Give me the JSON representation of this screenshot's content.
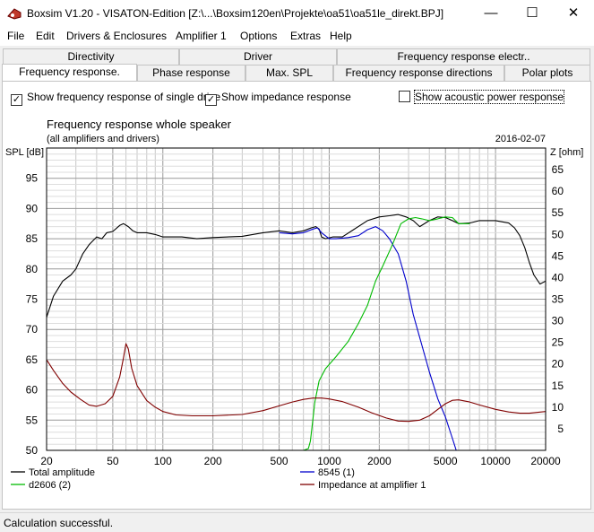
{
  "window": {
    "title": "Boxsim V1.20 - VISATON-Edition [Z:\\...\\Boxsim120en\\Projekte\\oa51\\oa51le_direkt.BPJ]",
    "minimize": "—",
    "maximize": "☐",
    "close": "✕"
  },
  "menu": [
    "File",
    "Edit",
    "Drivers & Enclosures",
    "Amplifier 1",
    "Options",
    "Extras",
    "Help"
  ],
  "tabs_row1": [
    "Directivity",
    "Driver",
    "Frequency response electr.."
  ],
  "tabs_row2": [
    "Frequency response.",
    "Phase response",
    "Max. SPL",
    "Frequency response directions",
    "Polar plots"
  ],
  "options": {
    "single_drive": {
      "label": "Show frequency response of single drive",
      "checked": true
    },
    "impedance": {
      "label": "Show impedance response",
      "checked": true
    },
    "acoustic_power": {
      "label": "Show acoustic power response",
      "checked": false
    }
  },
  "status": "Calculation successful.",
  "chart_data": {
    "type": "line",
    "title": "Frequency response whole speaker",
    "subtitle": "(all amplifiers and drivers)",
    "date": "2016-02-07",
    "ylabel": "SPL [dB]",
    "y2label": "Z [ohm]",
    "xscale": "log",
    "xlim": [
      20,
      20000
    ],
    "ylim": [
      50,
      100
    ],
    "y2lim": [
      0,
      70
    ],
    "x_ticks": [
      20,
      50,
      100,
      200,
      500,
      1000,
      2000,
      5000,
      10000,
      20000
    ],
    "x_tick_labels": [
      "20",
      "50",
      "100",
      "200",
      "500",
      "1000",
      "2000",
      "5000",
      "10000",
      "20000"
    ],
    "y_ticks": [
      50,
      55,
      60,
      65,
      70,
      75,
      80,
      85,
      90,
      95
    ],
    "y2_ticks": [
      5,
      10,
      15,
      20,
      25,
      30,
      35,
      40,
      45,
      50,
      55,
      60,
      65
    ],
    "grid": true,
    "legend_position": "bottom",
    "series": [
      {
        "name": "Total amplitude",
        "axis": "spl",
        "color": "#000000",
        "points": [
          [
            20,
            72
          ],
          [
            22,
            75.5
          ],
          [
            25,
            78
          ],
          [
            28,
            79
          ],
          [
            30,
            80
          ],
          [
            33,
            82.5
          ],
          [
            36,
            84
          ],
          [
            40,
            85.3
          ],
          [
            43,
            85
          ],
          [
            46,
            86
          ],
          [
            50,
            86.2
          ],
          [
            55,
            87.2
          ],
          [
            58,
            87.5
          ],
          [
            62,
            87
          ],
          [
            66,
            86.3
          ],
          [
            70,
            86
          ],
          [
            80,
            86
          ],
          [
            90,
            85.7
          ],
          [
            100,
            85.3
          ],
          [
            130,
            85.3
          ],
          [
            160,
            85
          ],
          [
            200,
            85.2
          ],
          [
            300,
            85.4
          ],
          [
            400,
            86
          ],
          [
            500,
            86.3
          ],
          [
            600,
            86
          ],
          [
            700,
            86.3
          ],
          [
            780,
            86.8
          ],
          [
            830,
            87
          ],
          [
            870,
            86.6
          ],
          [
            900,
            85.3
          ],
          [
            950,
            85
          ],
          [
            1050,
            85.3
          ],
          [
            1200,
            85.3
          ],
          [
            1400,
            86.5
          ],
          [
            1700,
            88
          ],
          [
            2000,
            88.6
          ],
          [
            2300,
            88.8
          ],
          [
            2600,
            89
          ],
          [
            2900,
            88.6
          ],
          [
            3200,
            88
          ],
          [
            3500,
            87
          ],
          [
            4000,
            88
          ],
          [
            4500,
            88.6
          ],
          [
            5000,
            88.5
          ],
          [
            5500,
            88
          ],
          [
            6000,
            87.5
          ],
          [
            7000,
            87.6
          ],
          [
            8000,
            88
          ],
          [
            10000,
            88
          ],
          [
            12000,
            87.6
          ],
          [
            13000,
            86.8
          ],
          [
            14000,
            85.5
          ],
          [
            15000,
            83.5
          ],
          [
            16000,
            81
          ],
          [
            17000,
            79
          ],
          [
            18500,
            77.5
          ],
          [
            20000,
            78
          ]
        ]
      },
      {
        "name": "8545 (1)",
        "axis": "spl",
        "color": "#0000cc",
        "points": [
          [
            500,
            86
          ],
          [
            600,
            85.8
          ],
          [
            700,
            86
          ],
          [
            800,
            86.6
          ],
          [
            850,
            86.8
          ],
          [
            900,
            86
          ],
          [
            1000,
            85
          ],
          [
            1100,
            85
          ],
          [
            1300,
            85.2
          ],
          [
            1500,
            85.5
          ],
          [
            1700,
            86.5
          ],
          [
            1900,
            87
          ],
          [
            2100,
            86.3
          ],
          [
            2300,
            85
          ],
          [
            2600,
            82.5
          ],
          [
            2900,
            78
          ],
          [
            3200,
            72.5
          ],
          [
            3600,
            67.5
          ],
          [
            4000,
            63
          ],
          [
            4500,
            58.5
          ],
          [
            5000,
            55.5
          ],
          [
            5500,
            52
          ],
          [
            5800,
            50
          ]
        ]
      },
      {
        "name": "d2606 (2)",
        "axis": "spl",
        "color": "#00bb00",
        "points": [
          [
            20,
            50
          ],
          [
            100,
            50
          ],
          [
            500,
            50
          ],
          [
            700,
            50
          ],
          [
            750,
            50.3
          ],
          [
            770,
            51.5
          ],
          [
            790,
            54
          ],
          [
            820,
            58
          ],
          [
            870,
            61.5
          ],
          [
            950,
            63.5
          ],
          [
            1100,
            65.5
          ],
          [
            1300,
            68
          ],
          [
            1500,
            71
          ],
          [
            1700,
            74
          ],
          [
            1900,
            78
          ],
          [
            2100,
            80.5
          ],
          [
            2400,
            84
          ],
          [
            2700,
            87.5
          ],
          [
            3000,
            88.3
          ],
          [
            3300,
            88.5
          ],
          [
            3600,
            88.3
          ],
          [
            4000,
            88
          ],
          [
            4500,
            88.3
          ],
          [
            5000,
            88.6
          ],
          [
            5500,
            88.5
          ],
          [
            6000,
            87.5
          ],
          [
            7000,
            87.5
          ]
        ]
      },
      {
        "name": "Impedance at amplifier 1",
        "axis": "impedance",
        "color": "#800000",
        "points": [
          [
            20,
            21
          ],
          [
            22,
            18.5
          ],
          [
            25,
            15.5
          ],
          [
            28,
            13.5
          ],
          [
            32,
            11.8
          ],
          [
            36,
            10.5
          ],
          [
            40,
            10.2
          ],
          [
            45,
            10.8
          ],
          [
            50,
            12.5
          ],
          [
            55,
            17
          ],
          [
            58,
            21.5
          ],
          [
            60,
            24.7
          ],
          [
            62,
            23.5
          ],
          [
            65,
            19
          ],
          [
            70,
            15
          ],
          [
            80,
            11.5
          ],
          [
            90,
            10
          ],
          [
            100,
            9
          ],
          [
            120,
            8.2
          ],
          [
            150,
            8
          ],
          [
            200,
            8
          ],
          [
            300,
            8.3
          ],
          [
            400,
            9.2
          ],
          [
            500,
            10.3
          ],
          [
            600,
            11.2
          ],
          [
            700,
            11.8
          ],
          [
            800,
            12.1
          ],
          [
            900,
            12.1
          ],
          [
            1000,
            11.9
          ],
          [
            1200,
            11.3
          ],
          [
            1500,
            10
          ],
          [
            1800,
            8.7
          ],
          [
            2200,
            7.5
          ],
          [
            2600,
            6.8
          ],
          [
            3000,
            6.7
          ],
          [
            3500,
            7
          ],
          [
            4000,
            8
          ],
          [
            4500,
            9.5
          ],
          [
            5000,
            10.8
          ],
          [
            5500,
            11.6
          ],
          [
            6000,
            11.7
          ],
          [
            7000,
            11.2
          ],
          [
            8000,
            10.5
          ],
          [
            10000,
            9.5
          ],
          [
            12000,
            8.9
          ],
          [
            14000,
            8.6
          ],
          [
            16000,
            8.6
          ],
          [
            18000,
            8.8
          ],
          [
            20000,
            9
          ]
        ]
      }
    ]
  }
}
